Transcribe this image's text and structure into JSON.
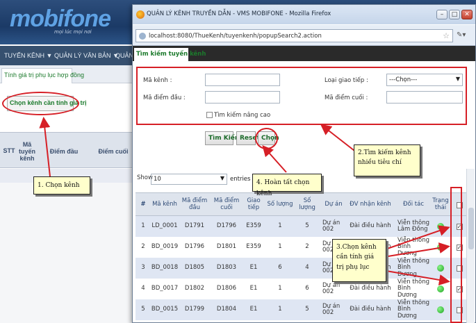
{
  "background_app": {
    "logo": "mobifone",
    "logo_sub": "mọi lúc mọi nơi",
    "nav": [
      "TUYẾN KÊNH ▼",
      "QUẢN LÝ VĂN BẢN ▼",
      "QUẢN L"
    ],
    "tab": "Tính giá trị phụ lục hợp đồng",
    "button": "Chọn kênh cần tính giá trị",
    "table_headers": {
      "stt": "STT",
      "ma_tuyen_kenh": "Mã tuyến kênh",
      "diem_dau": "Điểm đầu",
      "diem_cuoi": "Điểm cuối"
    }
  },
  "popup": {
    "window_title": "QUẢN LÝ KÊNH TRUYỀN DẪN - VMS MOBIFONE - Mozilla Firefox",
    "url": "localhost:8080/ThueKenh/tuyenkenh/popupSearch2.action",
    "page_tab": "Tìm kiếm tuyến kênh",
    "form": {
      "ma_kenh": "Mã kênh :",
      "ma_diem_dau": "Mã điểm đầu :",
      "loai_giao_tiep": "Loại giao tiếp :",
      "ma_diem_cuoi": "Mã điểm cuối :",
      "loai_giao_tiep_value": "---Chọn---",
      "advanced": "Tìm kiếm nâng cao"
    },
    "buttons": {
      "search": "Tìm Kiếm",
      "reset": "Reset",
      "choose": "Chọn"
    },
    "show_label": "Show",
    "show_value": "10",
    "entries_label": "entries",
    "grid": {
      "headers": {
        "no": "#",
        "ma_kenh": "Mã kênh",
        "ma_diem_dau": "Mã điểm đầu",
        "ma_diem_cuoi": "Mã điểm cuối",
        "giao_tiep": "Giao tiếp",
        "so_luong_1": "Số lượng",
        "so_luong_2": "Số lượng",
        "du_an": "Dự án",
        "dv_nhan_kenh": "ĐV nhận kênh",
        "doi_tac": "Đối tác",
        "trang_thai": "Trạng thái"
      },
      "rows": [
        {
          "no": "1",
          "ma_kenh": "LD_0001",
          "diem_dau": "D1791",
          "diem_cuoi": "D1796",
          "giao_tiep": "E359",
          "sl1": "1",
          "sl2": "5",
          "du_an": "Dự án 002",
          "dv": "Đài điều hành",
          "doi_tac": "Viễn thông Lâm Đồng",
          "checked": true
        },
        {
          "no": "2",
          "ma_kenh": "BD_0019",
          "diem_dau": "D1796",
          "diem_cuoi": "D1801",
          "giao_tiep": "E359",
          "sl1": "1",
          "sl2": "2",
          "du_an": "Dự án 002",
          "dv": "Đài điều hành",
          "doi_tac": "Viễn thông Bình Dương",
          "checked": true
        },
        {
          "no": "3",
          "ma_kenh": "BD_0018",
          "diem_dau": "D1805",
          "diem_cuoi": "D1803",
          "giao_tiep": "E1",
          "sl1": "6",
          "sl2": "4",
          "du_an": "Dự án 002",
          "dv": "Đài điều hành",
          "doi_tac": "Viễn thông Bình Dương",
          "checked": false
        },
        {
          "no": "4",
          "ma_kenh": "BD_0017",
          "diem_dau": "D1802",
          "diem_cuoi": "D1806",
          "giao_tiep": "E1",
          "sl1": "1",
          "sl2": "6",
          "du_an": "Dự án 002",
          "dv": "Đài điều hành",
          "doi_tac": "Viễn thông Bình Dương",
          "checked": true
        },
        {
          "no": "5",
          "ma_kenh": "BD_0015",
          "diem_dau": "D1799",
          "diem_cuoi": "D1804",
          "giao_tiep": "E1",
          "sl1": "1",
          "sl2": "5",
          "du_an": "Dự án 002",
          "dv": "Đài điều hành",
          "doi_tac": "Viễn thông Bình Dương",
          "checked": false
        }
      ]
    }
  },
  "annotations": {
    "step1": "1. Chọn kênh",
    "step2": "2.Tìm kiếm kênh nhiều tiêu chí",
    "step3": "3.Chọn kênh cần tính giá trị phụ lục",
    "step4": "4. Hoàn tất chọn kênh"
  },
  "colors": {
    "annotation_red": "#d61f26",
    "callout_bg": "#ffffcc",
    "link_green": "#1c7a2c",
    "header_blue": "#1b3a66"
  }
}
